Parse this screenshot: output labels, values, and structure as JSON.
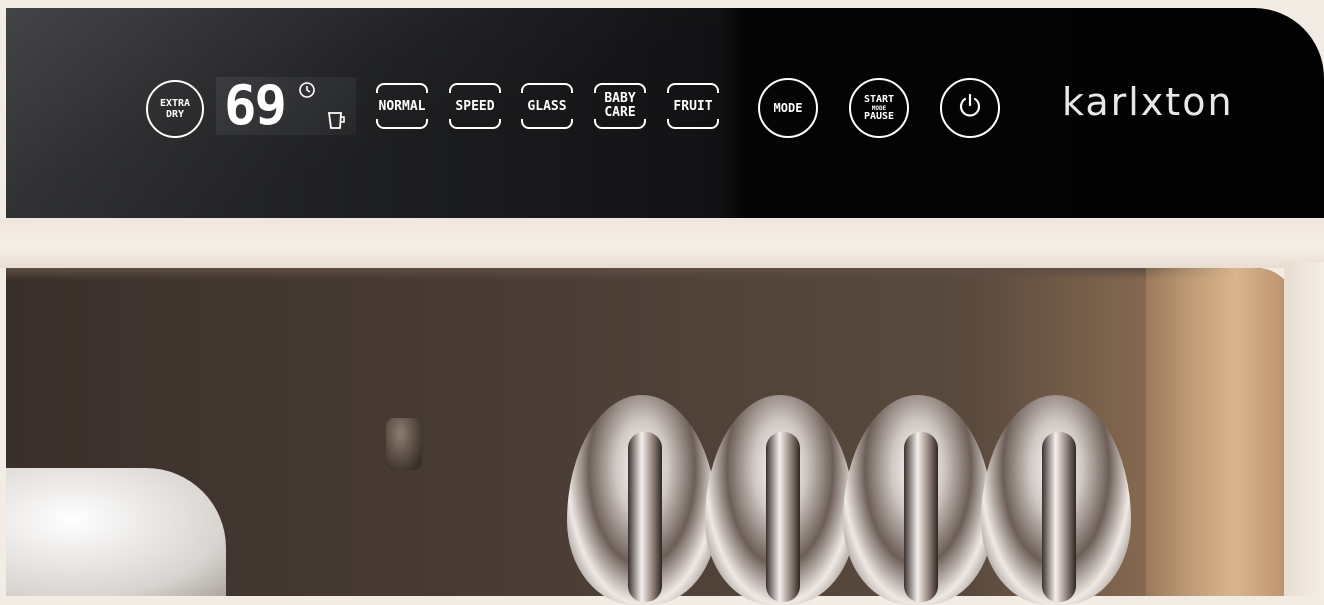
{
  "control_panel": {
    "extra_dry_line1": "EXTRA",
    "extra_dry_line2": "DRY",
    "display_value": "69",
    "programs": [
      {
        "label": "NORMAL"
      },
      {
        "label": "SPEED"
      },
      {
        "label": "GLASS"
      },
      {
        "label_line1": "BABY",
        "label_line2": "CARE"
      },
      {
        "label": "FRUIT"
      }
    ],
    "mode_label": "MODE",
    "start_line1": "START",
    "start_line2": "MODE",
    "start_line3": "PAUSE",
    "brand": "karlxton"
  },
  "icons": [
    "clock-icon",
    "cup-icon",
    "power-icon"
  ],
  "colors": {
    "panel": "#050505",
    "text": "#ffffff",
    "body": "#f2ece4"
  }
}
